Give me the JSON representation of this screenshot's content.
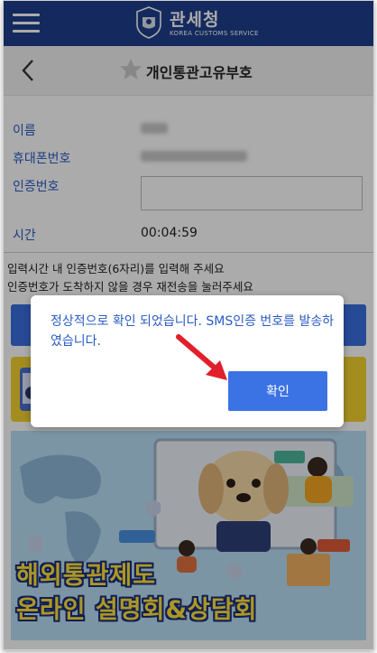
{
  "header": {
    "brand_kr": "관세청",
    "brand_en": "KOREA CUSTOMS SERVICE",
    "menu_icon": "hamburger-menu-icon",
    "logo_icon": "customs-emblem-icon",
    "bar_color": "#1f3f8c"
  },
  "subheader": {
    "title": "개인통관고유부호",
    "back_icon": "chevron-left-icon",
    "star_icon": "star-icon"
  },
  "form": {
    "name_label": "이름",
    "phone_label": "휴대폰번호",
    "code_label": "인증번호",
    "time_label": "시간",
    "time_value": "00:04:59"
  },
  "help": {
    "line1": "입력시간 내 인증번호(6자리)를 입력해 주세요",
    "line2": "인증번호가 도착하지 않을 경우 재전송을 눌러주세요"
  },
  "banner": {
    "line1": "해외통관제도",
    "line2": "온라인 설명회&상담회"
  },
  "dialog": {
    "message": "정상적으로 확인 되었습니다. SMS인증 번호를 발송하였습니다.",
    "confirm_label": "확인",
    "accent": "#3c73e4",
    "arrow_color": "#e0202a"
  }
}
